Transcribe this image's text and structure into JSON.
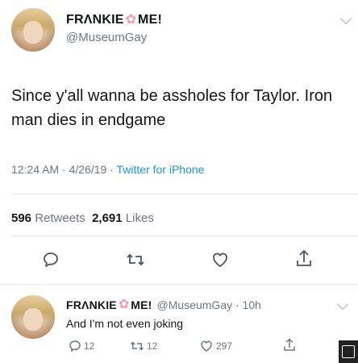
{
  "main_tweet": {
    "display_name_part1": "FRΛNKIE",
    "display_name_part2": "ME!",
    "handle": "@MuseumGay",
    "text": "Since y'all wanna be assholes for Taylor. Iron man dies in endgame",
    "timestamp": "12:24 AM · 4/26/19 · ",
    "source": "Twitter for iPhone",
    "retweets_count": "596",
    "retweets_label": "Retweets",
    "likes_count": "2,691",
    "likes_label": "Likes"
  },
  "reply_tweet": {
    "display_name_part1": "FRΛNKIE",
    "display_name_part2": "ME!",
    "handle_time": "@MuseumGay · 10h",
    "text": "And I'm not even joking",
    "reply_count": "12",
    "retweet_count": "12",
    "like_count": "297"
  },
  "icons": {
    "chevron": "chevron-down-icon",
    "reply": "reply-icon",
    "retweet": "retweet-icon",
    "like": "heart-icon",
    "share": "share-icon",
    "flower": "flower-emoji-icon"
  },
  "colors": {
    "text": "#14171a",
    "secondary": "#6b7785",
    "link": "#1b95e0",
    "flower": "#f39ab0"
  }
}
